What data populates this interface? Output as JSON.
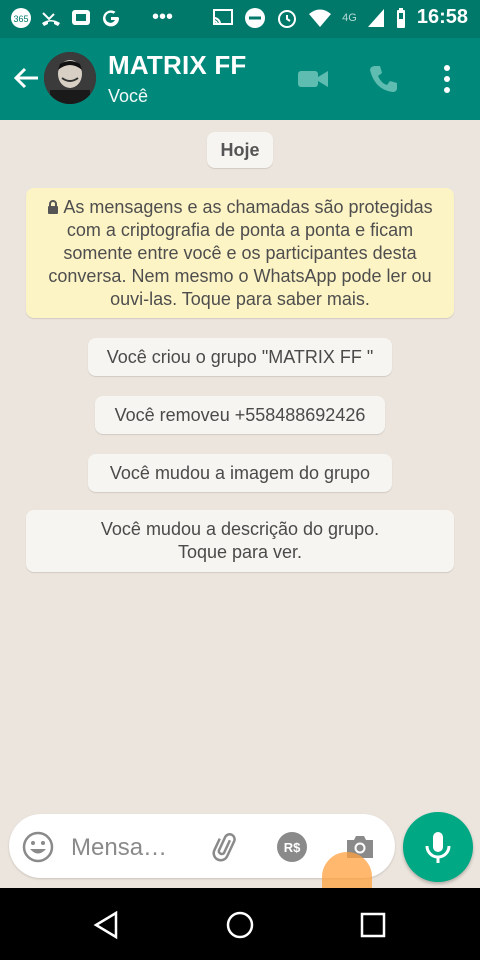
{
  "status_bar": {
    "left_icons": [
      "365-icon",
      "missed-call-icon",
      "tv-icon",
      "google-icon",
      "more-dots-icon"
    ],
    "right_icons": [
      "cast-icon",
      "do-not-disturb-icon",
      "alarm-icon",
      "wifi-icon",
      "signal-icon",
      "battery-icon"
    ],
    "network": "4G",
    "time": "16:58"
  },
  "toolbar": {
    "title": "MATRIX FF",
    "subtitle": "Você",
    "color": "#00897B"
  },
  "chat": {
    "date_label": "Hoje",
    "encryption_notice": "As mensagens e as chamadas são protegidas com a criptografia de ponta a ponta e ficam somente entre você e os participantes desta conversa. Nem mesmo o WhatsApp pode ler ou ouvi-las. Toque para saber mais.",
    "system_messages": [
      "Você criou o grupo \"MATRIX FF \"",
      "Você removeu +558488692426",
      "Você mudou a imagem do grupo",
      "Você mudou a descrição do grupo.\nToque para ver."
    ]
  },
  "composer": {
    "placeholder": "Mensa…",
    "icons": [
      "emoji-icon",
      "attach-icon",
      "payment-icon",
      "camera-icon"
    ],
    "mic_color": "#00A884"
  }
}
